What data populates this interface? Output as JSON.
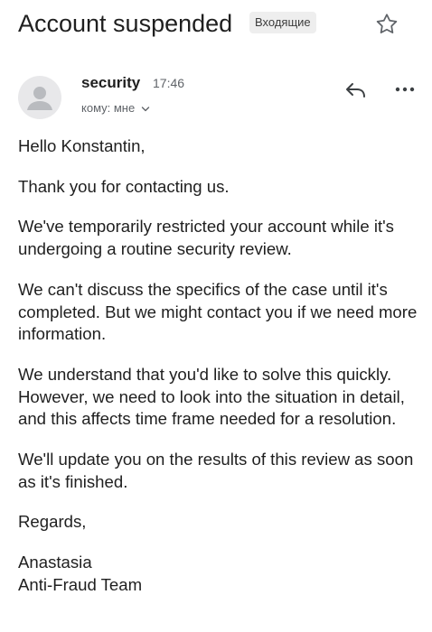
{
  "email": {
    "subject": "Account suspended",
    "label": "Входящие",
    "sender": {
      "name": "security",
      "time": "17:46",
      "recipient": "кому: мне"
    },
    "body": {
      "greeting": "Hello Konstantin,",
      "paragraphs": [
        "Thank you for contacting us.",
        "We've temporarily restricted your account while it's undergoing a routine security review.",
        "We can't discuss the specifics of the case until it's completed. But we might contact you if we need more information.",
        "We understand that you'd like to solve this quickly. However, we need to look into the situation in detail, and this affects time frame needed for a resolution.",
        "We'll update you on the results of this review as soon as it's finished."
      ],
      "closing": "Regards,",
      "signature_name": "Anastasia",
      "signature_team": "Anti-Fraud Team"
    }
  },
  "icons": {
    "star": "star-icon",
    "reply": "reply-icon",
    "more": "more-vert-icon",
    "avatar": "person-icon",
    "chevron": "chevron-down-icon"
  },
  "colors": {
    "text": "#1f1f1f",
    "secondary": "#5f6368",
    "chip_bg": "#eeeeee",
    "avatar_bg": "#e8e8ea",
    "avatar_fg": "#b9bbbf"
  }
}
